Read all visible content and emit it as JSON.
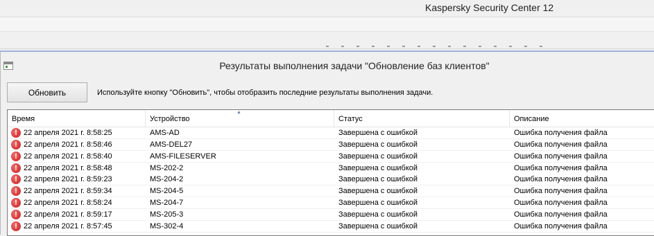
{
  "app": {
    "title": "Kaspersky Security Center 12"
  },
  "dialog": {
    "title": "Результаты выполнения задачи \"Обновление баз клиентов\"",
    "refresh_label": "Обновить",
    "hint": "Используйте кнопку \"Обновить\", чтобы отобразить последние результаты выполнения задачи."
  },
  "table": {
    "columns": [
      "Время",
      "Устройство",
      "Статус",
      "Описание"
    ],
    "sorted_column": "Устройство",
    "rows": [
      {
        "icon": "error-icon",
        "time": "22 апреля 2021 г. 8:58:25",
        "device": "AMS-AD",
        "status": "Завершена с ошибкой",
        "description": "Ошибка получения файла"
      },
      {
        "icon": "error-icon",
        "time": "22 апреля 2021 г. 8:58:46",
        "device": "AMS-DEL27",
        "status": "Завершена с ошибкой",
        "description": "Ошибка получения файла"
      },
      {
        "icon": "error-icon",
        "time": "22 апреля 2021 г. 8:58:40",
        "device": "AMS-FILESERVER",
        "status": "Завершена с ошибкой",
        "description": "Ошибка получения файла"
      },
      {
        "icon": "error-icon",
        "time": "22 апреля 2021 г. 8:58:48",
        "device": "MS-202-2",
        "status": "Завершена с ошибкой",
        "description": "Ошибка получения файла"
      },
      {
        "icon": "error-icon",
        "time": "22 апреля 2021 г. 8:59:23",
        "device": "MS-204-2",
        "status": "Завершена с ошибкой",
        "description": "Ошибка получения файла"
      },
      {
        "icon": "error-icon",
        "time": "22 апреля 2021 г. 8:59:34",
        "device": "MS-204-5",
        "status": "Завершена с ошибкой",
        "description": "Ошибка получения файла"
      },
      {
        "icon": "error-icon",
        "time": "22 апреля 2021 г. 8:58:24",
        "device": "MS-204-7",
        "status": "Завершена с ошибкой",
        "description": "Ошибка получения файла"
      },
      {
        "icon": "error-icon",
        "time": "22 апреля 2021 г. 8:59:17",
        "device": "MS-205-3",
        "status": "Завершена с ошибкой",
        "description": "Ошибка получения файла"
      },
      {
        "icon": "error-icon",
        "time": "22 апреля 2021 г. 8:57:45",
        "device": "MS-302-4",
        "status": "Завершена с ошибкой",
        "description": "Ошибка получения файла"
      }
    ]
  },
  "colors": {
    "error": "#d32f2f",
    "accent": "#9fb3d8"
  }
}
